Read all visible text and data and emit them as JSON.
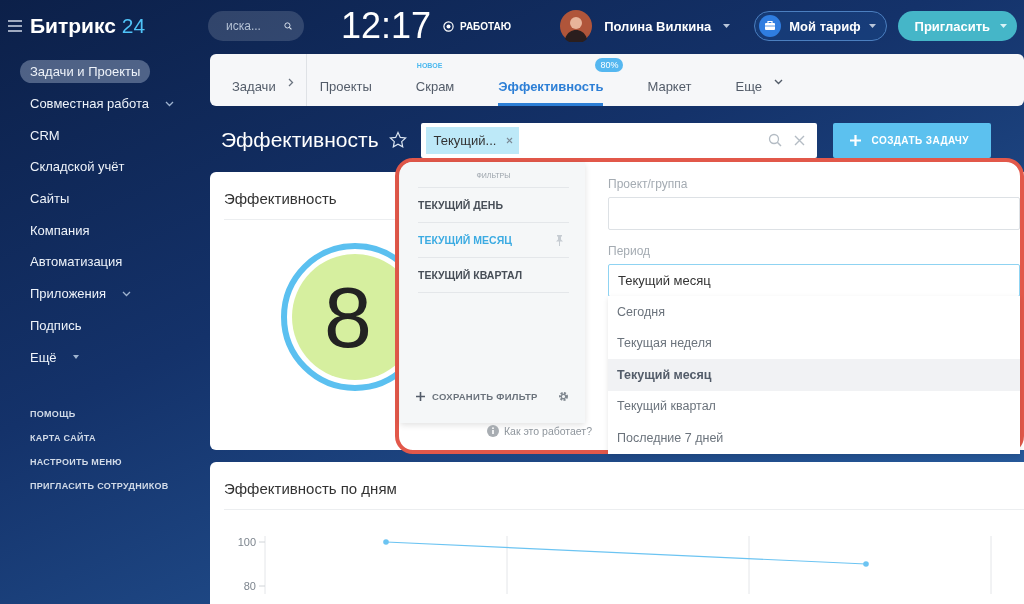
{
  "sidebar": {
    "logo": {
      "name": "Битрикс",
      "number": "24"
    },
    "items": [
      {
        "label": "Задачи и Проекты",
        "selected": true,
        "kind": "plain"
      },
      {
        "label": "Совместная работа",
        "selected": false,
        "kind": "submenu"
      },
      {
        "label": "CRM",
        "selected": false,
        "kind": "plain"
      },
      {
        "label": "Складской учёт",
        "selected": false,
        "kind": "plain"
      },
      {
        "label": "Сайты",
        "selected": false,
        "kind": "plain"
      },
      {
        "label": "Компания",
        "selected": false,
        "kind": "plain"
      },
      {
        "label": "Автоматизация",
        "selected": false,
        "kind": "plain"
      },
      {
        "label": "Приложения",
        "selected": false,
        "kind": "submenu"
      },
      {
        "label": "Подпись",
        "selected": false,
        "kind": "plain"
      },
      {
        "label": "Ещё",
        "selected": false,
        "kind": "more"
      }
    ],
    "footer_links": [
      "ПОМОЩЬ",
      "КАРТА САЙТА",
      "НАСТРОИТЬ МЕНЮ",
      "ПРИГЛАСИТЬ СОТРУДНИКОВ"
    ]
  },
  "header": {
    "search": {
      "placeholder": "иска..."
    },
    "clock": "12:17",
    "status": "РАБОТАЮ",
    "user": {
      "name": "Полина Вилкина"
    },
    "tariff_button": "Мой тариф",
    "invite_button": "Пригласить"
  },
  "tabs": [
    {
      "label": "Задачи",
      "selected": false,
      "kind": "root"
    },
    {
      "label": "Проекты",
      "selected": false,
      "kind": "plain"
    },
    {
      "label": "Скрам",
      "selected": false,
      "kind": "plain",
      "note": "НОВОЕ"
    },
    {
      "label": "Эффективность",
      "selected": true,
      "kind": "plain",
      "badge": "80%"
    },
    {
      "label": "Маркет",
      "selected": false,
      "kind": "plain"
    },
    {
      "label": "Еще",
      "selected": false,
      "kind": "more"
    }
  ],
  "page": {
    "title": "Эффективность",
    "filter": {
      "tag": "Текущий..."
    },
    "create_button": "СОЗДАТЬ ЗАДАЧУ"
  },
  "efficiency_card": {
    "title": "Эффективность",
    "gauge_value": "8"
  },
  "daily_card": {
    "title": "Эффективность по дням",
    "axis_labels": [
      "100",
      "80"
    ]
  },
  "filter_popup": {
    "heading": "ФИЛЬТРЫ",
    "presets": [
      {
        "label": "ТЕКУЩИЙ ДЕНЬ",
        "selected": false,
        "pinned": false
      },
      {
        "label": "ТЕКУЩИЙ МЕСЯЦ",
        "selected": true,
        "pinned": true
      },
      {
        "label": "ТЕКУЩИЙ КВАРТАЛ",
        "selected": false,
        "pinned": false
      }
    ],
    "save_button": "СОХРАНИТЬ ФИЛЬТР",
    "help": "Как это работает?",
    "project_field": {
      "label": "Проект/группа"
    },
    "period": {
      "label": "Период",
      "value": "Текущий месяц",
      "options": [
        {
          "label": "Сегодня",
          "selected": false
        },
        {
          "label": "Текущая неделя",
          "selected": false
        },
        {
          "label": "Текущий месяц",
          "selected": true
        },
        {
          "label": "Текущий квартал",
          "selected": false
        },
        {
          "label": "Последние 7 дней",
          "selected": false
        }
      ]
    }
  }
}
